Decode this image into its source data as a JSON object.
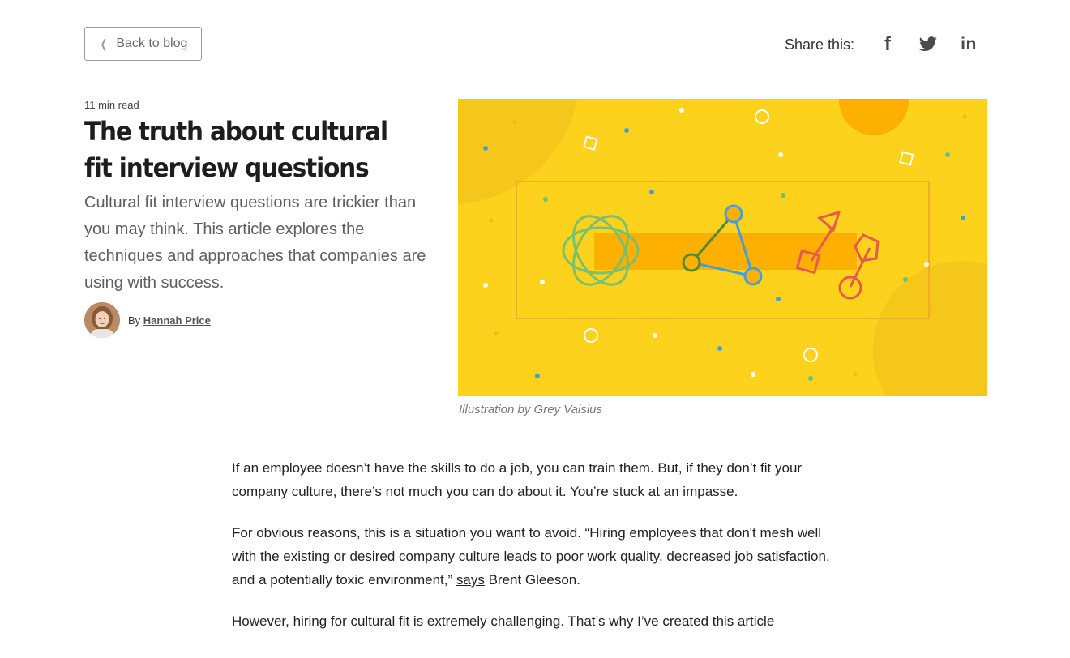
{
  "nav": {
    "back_label": "Back to blog"
  },
  "share": {
    "label": "Share this:",
    "icons": [
      "facebook-icon",
      "twitter-icon",
      "linkedin-icon"
    ],
    "facebook_glyph": "f",
    "linkedin_glyph": "in"
  },
  "article": {
    "read_time": "11 min read",
    "title": "The truth about cultural fit interview questions",
    "subtitle": "Cultural fit interview questions are trickier than you may think. This article explores the techniques and approaches that companies are using with success.",
    "author_prefix": "By",
    "author_name": "Hannah Price",
    "hero_caption": "Illustration by Grey Vaisius",
    "paragraphs": {
      "p1": "If an employee doesn’t have the skills to do a job, you can train them. But, if they don’t fit your company culture, there’s not much you can do about it. You’re stuck at an impasse.",
      "p2_before": "For obvious reasons, this is a situation you want to avoid. “Hiring employees that don't mesh well with the existing or desired company culture leads to poor work quality, decreased job satisfaction, and a potentially toxic environment,” ",
      "p2_link": "says",
      "p2_after": " Brent Gleeson.",
      "p3": "However, hiring for cultural fit is extremely challenging. That’s why I’ve created this article"
    }
  },
  "colors": {
    "hero_background": "#fcd21c",
    "hero_accent": "#fdb000",
    "hero_outline": "#f28c28",
    "green": "#6cbf7a",
    "blue": "#4a9ed6",
    "red": "#e85a4a"
  }
}
